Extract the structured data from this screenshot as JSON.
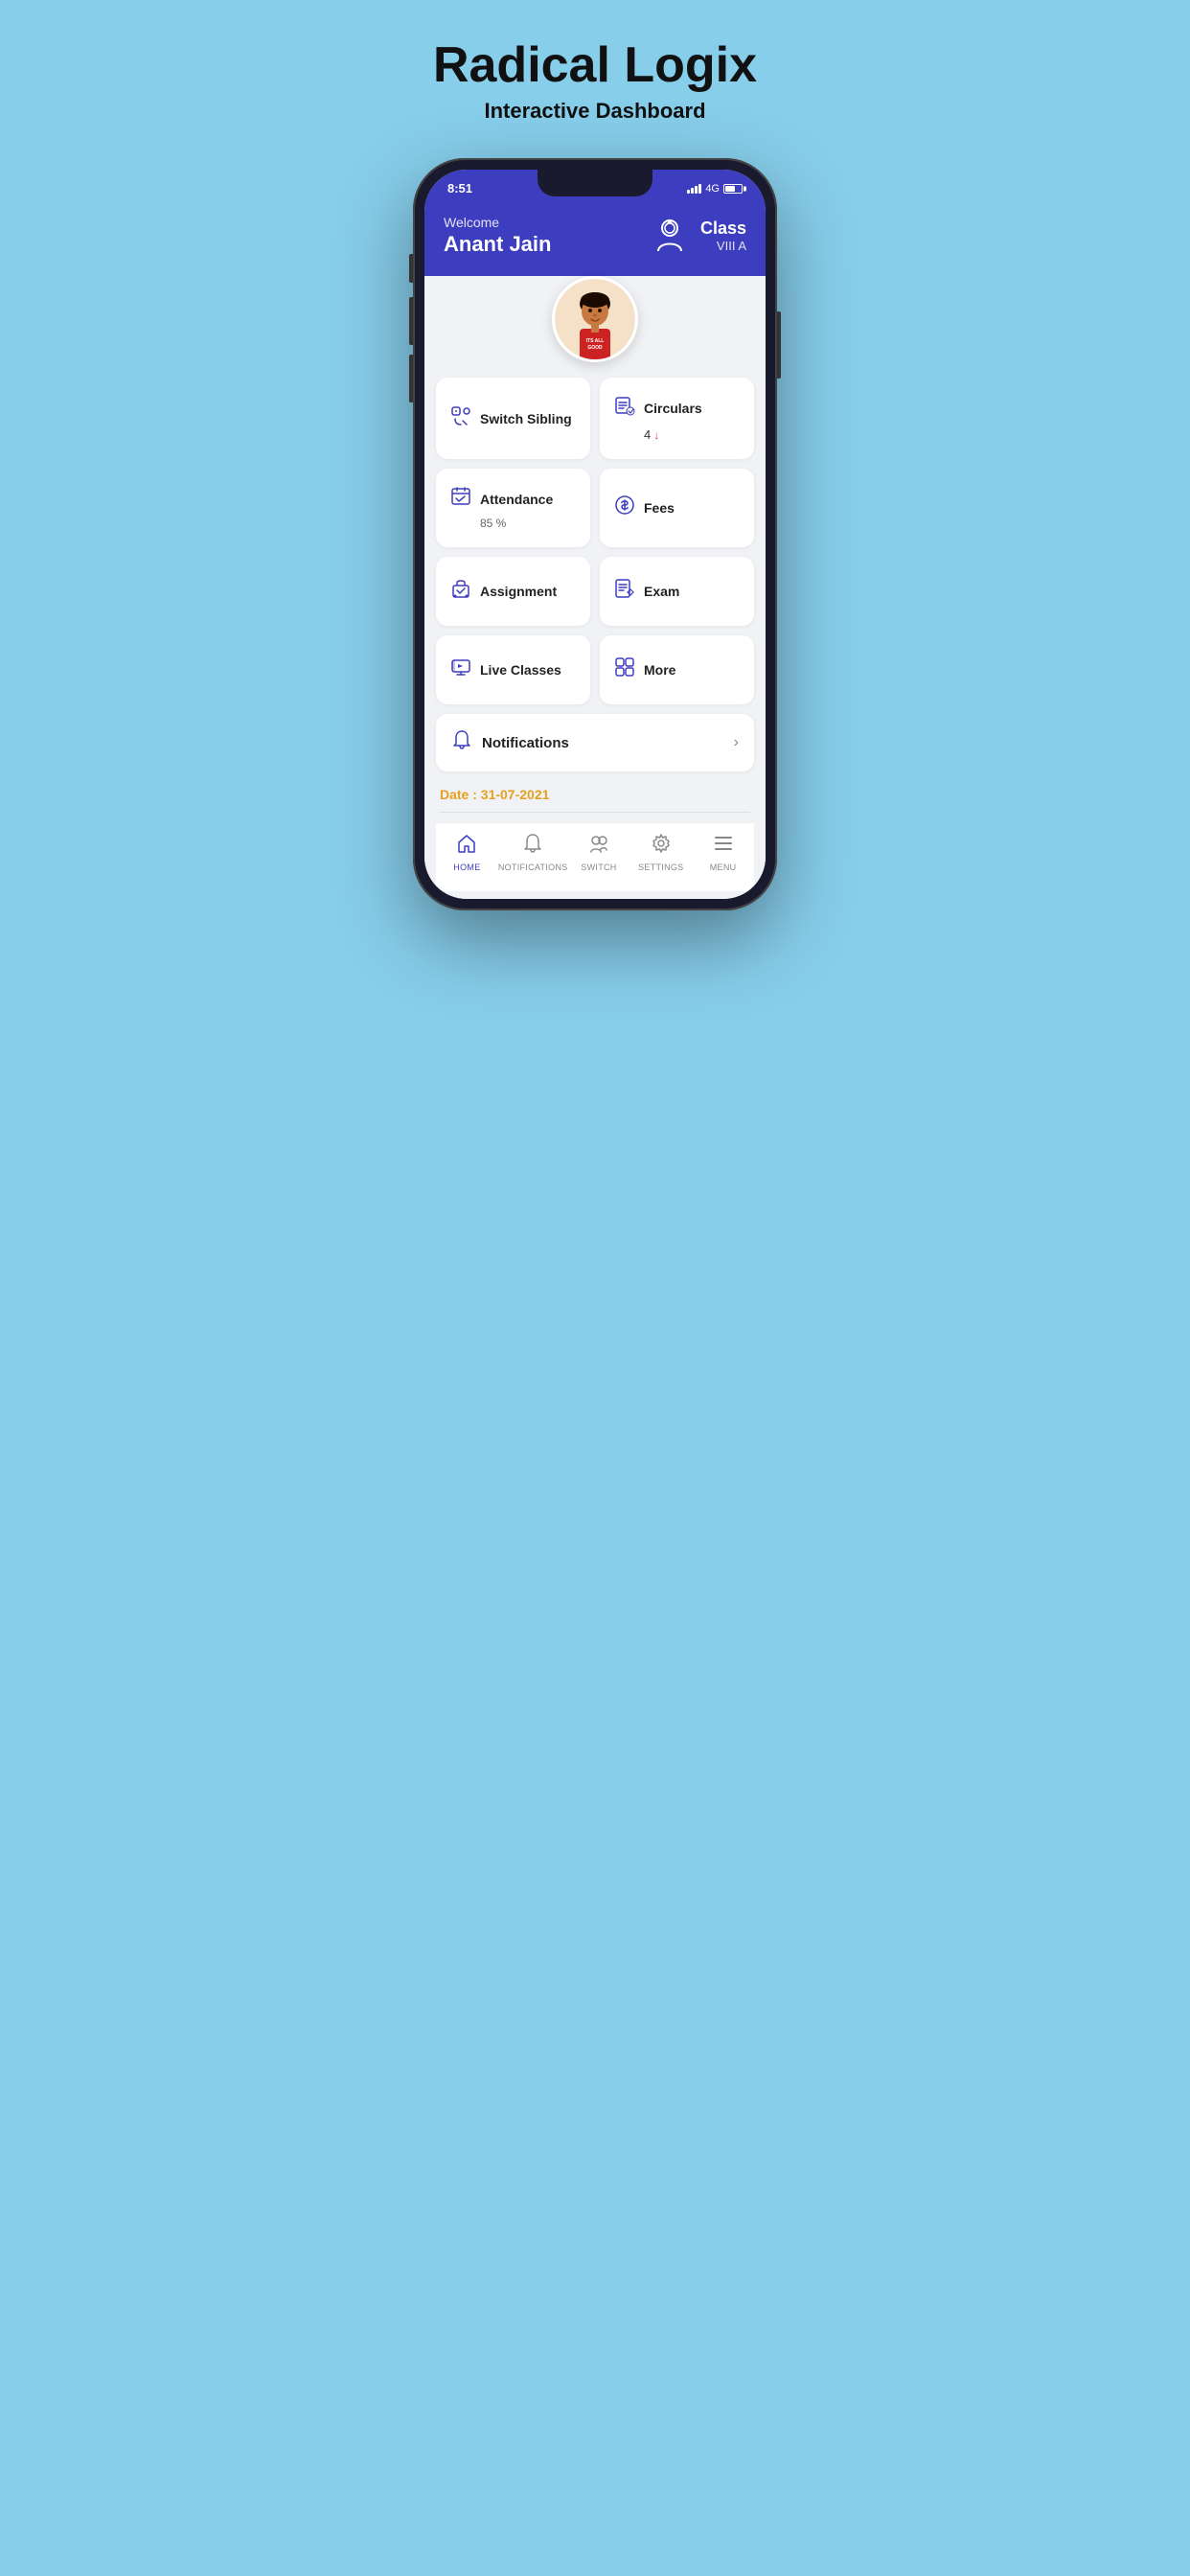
{
  "page": {
    "title": "Radical Logix",
    "subtitle_normal": "Interactive ",
    "subtitle_bold": "Dashboard"
  },
  "status_bar": {
    "time": "8:51",
    "network": "4G"
  },
  "header": {
    "welcome_text": "Welcome",
    "user_name": "Anant  Jain",
    "class_label": "Class",
    "class_grade": "VIII A"
  },
  "profile": {
    "shirt_text": "ITS ALL GOOD"
  },
  "menu_cards": [
    {
      "id": "switch-sibling",
      "label": "Switch Sibling",
      "sub": "",
      "badge": "",
      "icon": "switch"
    },
    {
      "id": "circulars",
      "label": "Circulars",
      "sub": "",
      "badge": "4",
      "icon": "circulars"
    },
    {
      "id": "attendance",
      "label": "Attendance",
      "sub": "85 %",
      "badge": "",
      "icon": "attendance"
    },
    {
      "id": "fees",
      "label": "Fees",
      "sub": "",
      "badge": "",
      "icon": "fees"
    },
    {
      "id": "assignment",
      "label": "Assignment",
      "sub": "",
      "badge": "",
      "icon": "assignment"
    },
    {
      "id": "exam",
      "label": "Exam",
      "sub": "",
      "badge": "",
      "icon": "exam"
    },
    {
      "id": "live-classes",
      "label": "Live Classes",
      "sub": "",
      "badge": "",
      "icon": "live"
    },
    {
      "id": "more",
      "label": "More",
      "sub": "",
      "badge": "",
      "icon": "more"
    }
  ],
  "notifications": {
    "label": "Notifications"
  },
  "date": {
    "label": "Date : 31-07-2021"
  },
  "bottom_nav": [
    {
      "id": "home",
      "label": "HOME",
      "icon": "🏠",
      "active": true
    },
    {
      "id": "notifications",
      "label": "NOTIFICATIONS",
      "icon": "🔔",
      "active": false
    },
    {
      "id": "switch",
      "label": "SWITCH",
      "icon": "👥",
      "active": false
    },
    {
      "id": "settings",
      "label": "SETTINGS",
      "icon": "⚙️",
      "active": false
    },
    {
      "id": "menu",
      "label": "MENU",
      "icon": "☰",
      "active": false
    }
  ]
}
